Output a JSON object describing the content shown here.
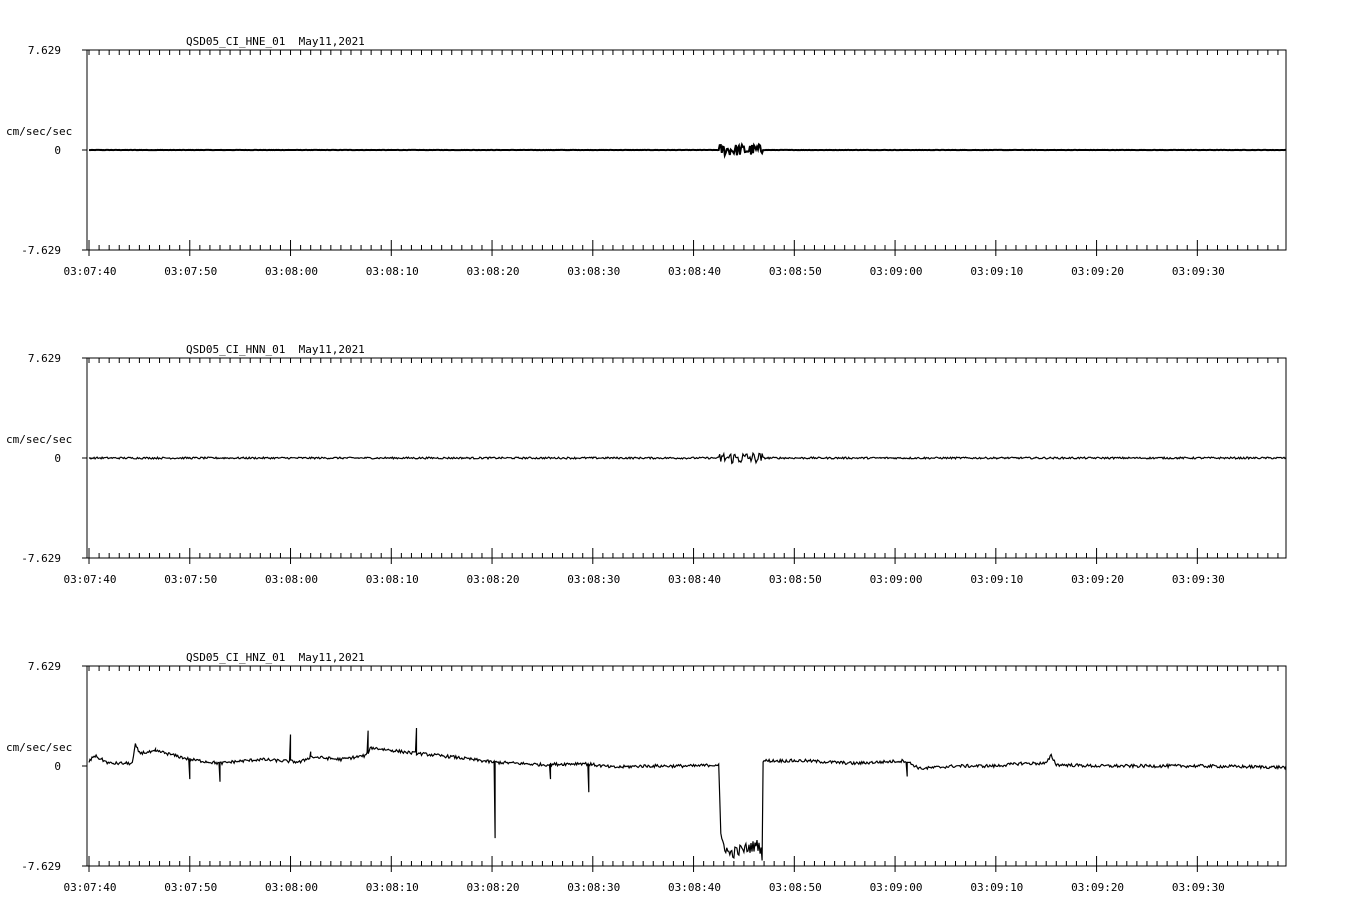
{
  "chart_data": [
    {
      "type": "line",
      "title": "QSD05_CI_HNE_01  May11,2021",
      "ylabel": "cm/sec/sec",
      "ylim": [
        -7.629,
        7.629
      ],
      "y_tick_labels": [
        "7.629",
        "0",
        "-7.629"
      ],
      "x_tick_labels": [
        "03:07:40",
        "03:07:50",
        "03:08:00",
        "03:08:10",
        "03:08:20",
        "03:08:30",
        "03:08:40",
        "03:08:50",
        "03:09:00",
        "03:09:10",
        "03:09:20",
        "03:09:30"
      ],
      "x_range_seconds_after_030740": [
        -0.2,
        118.8
      ],
      "trace_color": "#000000",
      "noise_amplitude": 0.01,
      "segments": [
        [
          0,
          0.0
        ],
        [
          118.8,
          0.0
        ]
      ]
    },
    {
      "type": "line",
      "title": "QSD05_CI_HNN_01  May11,2021",
      "ylabel": "cm/sec/sec",
      "ylim": [
        -7.629,
        7.629
      ],
      "y_tick_labels": [
        "7.629",
        "0",
        "-7.629"
      ],
      "x_tick_labels": [
        "03:07:40",
        "03:07:50",
        "03:08:00",
        "03:08:10",
        "03:08:20",
        "03:08:30",
        "03:08:40",
        "03:08:50",
        "03:09:00",
        "03:09:10",
        "03:09:20",
        "03:09:30"
      ],
      "x_range_seconds_after_030740": [
        -0.2,
        118.8
      ],
      "trace_color": "#000000",
      "noise_amplitude": 0.07,
      "segments": [
        [
          0,
          0.0
        ],
        [
          118.8,
          0.0
        ]
      ]
    },
    {
      "type": "line",
      "title": "QSD05_CI_HNZ_01  May11,2021",
      "ylabel": "cm/sec/sec",
      "ylim": [
        -7.629,
        7.629
      ],
      "y_tick_labels": [
        "7.629",
        "0",
        "-7.629"
      ],
      "x_tick_labels": [
        "03:07:40",
        "03:07:50",
        "03:08:00",
        "03:08:10",
        "03:08:20",
        "03:08:30",
        "03:08:40",
        "03:08:50",
        "03:09:00",
        "03:09:10",
        "03:09:20",
        "03:09:30"
      ],
      "x_range_seconds_after_030740": [
        -0.2,
        118.8
      ],
      "trace_color": "#000000",
      "noise_amplitude": 0.12,
      "segments": [
        [
          0,
          0.3
        ],
        [
          0.5,
          0.8
        ],
        [
          2.0,
          0.2
        ],
        [
          4.3,
          0.2
        ],
        [
          4.6,
          1.6
        ],
        [
          5.0,
          1.0
        ],
        [
          7.0,
          1.1
        ],
        [
          10.0,
          0.5
        ],
        [
          13.0,
          0.2
        ],
        [
          14.0,
          0.3
        ],
        [
          17.0,
          0.5
        ],
        [
          21.0,
          0.3
        ],
        [
          22.0,
          0.7
        ],
        [
          25.0,
          0.5
        ],
        [
          27.5,
          0.8
        ],
        [
          28.0,
          1.4
        ],
        [
          32.0,
          1.0
        ],
        [
          36.0,
          0.7
        ],
        [
          40.0,
          0.3
        ],
        [
          45.0,
          0.1
        ],
        [
          49.0,
          0.2
        ],
        [
          52.0,
          -0.1
        ],
        [
          55.0,
          0.0
        ],
        [
          60.0,
          0.0
        ],
        [
          62.5,
          0.1
        ],
        [
          62.7,
          -5.5
        ],
        [
          63.5,
          -6.7
        ],
        [
          66.5,
          -6.0
        ],
        [
          66.8,
          -6.8
        ],
        [
          66.9,
          0.4
        ],
        [
          71.0,
          0.4
        ],
        [
          76.0,
          0.2
        ],
        [
          81.0,
          0.4
        ],
        [
          82.5,
          -0.2
        ],
        [
          86.0,
          0.0
        ],
        [
          90.0,
          0.0
        ],
        [
          92.5,
          0.2
        ],
        [
          95.0,
          0.2
        ],
        [
          95.5,
          0.8
        ],
        [
          96.0,
          0.1
        ],
        [
          100.0,
          0.0
        ],
        [
          105.0,
          0.0
        ],
        [
          110.0,
          0.0
        ],
        [
          118.8,
          -0.1
        ]
      ],
      "spikes": [
        [
          40.3,
          -5.5
        ],
        [
          49.6,
          -2.0
        ],
        [
          20.0,
          2.4
        ],
        [
          27.7,
          2.7
        ],
        [
          32.5,
          2.9
        ],
        [
          22.0,
          1.1
        ],
        [
          6.6,
          1.3
        ],
        [
          10.0,
          -1.0
        ],
        [
          13.0,
          -1.2
        ],
        [
          45.8,
          -1.0
        ],
        [
          81.2,
          -0.8
        ]
      ]
    }
  ]
}
